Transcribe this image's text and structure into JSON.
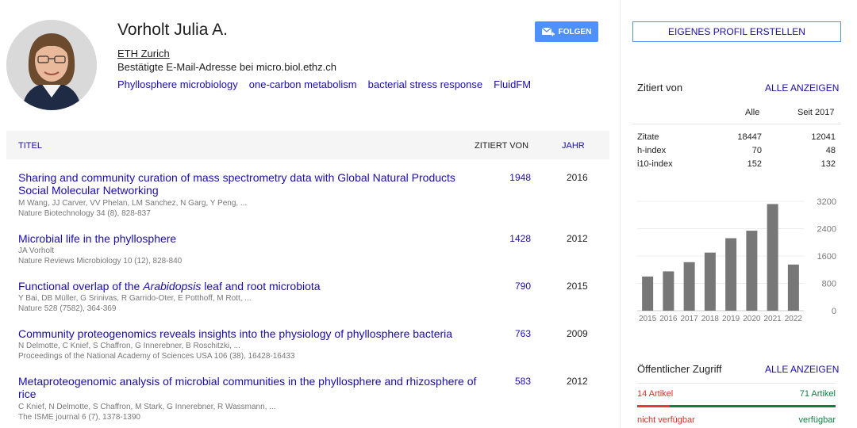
{
  "profile": {
    "name": "Vorholt Julia A.",
    "affiliation": "ETH Zurich",
    "email_status": "Bestätigte E-Mail-Adresse bei micro.biol.ethz.ch",
    "interests": [
      "Phyllosphere microbiology",
      "one-carbon metabolism",
      "bacterial stress response",
      "FluidFM"
    ],
    "follow_label": "FOLGEN",
    "create_profile_label": "EIGENES PROFIL ERSTELLEN"
  },
  "table": {
    "headers": {
      "title": "TITEL",
      "cited_by": "ZITIERT VON",
      "year": "JAHR"
    },
    "rows": [
      {
        "title": "Sharing and community curation of mass spectrometry data with Global Natural Products Social Molecular Networking",
        "authors": "M Wang, JJ Carver, VV Phelan, LM Sanchez, N Garg, Y Peng, ...",
        "venue": "Nature Biotechnology 34 (8), 828-837",
        "cited_by": "1948",
        "year": "2016"
      },
      {
        "title": "Microbial life in the phyllosphere",
        "authors": "JA Vorholt",
        "venue": "Nature Reviews Microbiology 10 (12), 828-840",
        "cited_by": "1428",
        "year": "2012"
      },
      {
        "title_pre": "Functional overlap of the ",
        "title_em": "Arabidopsis",
        "title_post": " leaf and root microbiota",
        "authors": "Y Bai, DB Müller, G Srinivas, R Garrido-Oter, E Potthoff, M Rott, ...",
        "venue": "Nature 528 (7582), 364-369",
        "cited_by": "790",
        "year": "2015"
      },
      {
        "title": "Community proteogenomics reveals insights into the physiology of phyllosphere bacteria",
        "authors": "N Delmotte, C Knief, S Chaffron, G Innerebner, B Roschitzki, ...",
        "venue": "Proceedings of the National Academy of Sciences USA 106 (38), 16428-16433",
        "cited_by": "763",
        "year": "2009"
      },
      {
        "title": "Metaproteogenomic analysis of microbial communities in the phyllosphere and rhizosphere of rice",
        "authors": "C Knief, N Delmotte, S Chaffron, M Stark, G Innerebner, R Wassmann, ...",
        "venue": "The ISME journal 6 (7), 1378-1390",
        "cited_by": "583",
        "year": "2012"
      }
    ]
  },
  "cited_by": {
    "title": "Zitiert von",
    "view_all": "ALLE ANZEIGEN",
    "col_all": "Alle",
    "col_since": "Seit 2017",
    "rows": [
      {
        "label": "Zitate",
        "all": "18447",
        "since": "12041"
      },
      {
        "label": "h-index",
        "all": "70",
        "since": "48"
      },
      {
        "label": "i10-index",
        "all": "152",
        "since": "132"
      }
    ]
  },
  "chart_data": {
    "type": "bar",
    "categories": [
      "2015",
      "2016",
      "2017",
      "2018",
      "2019",
      "2020",
      "2021",
      "2022"
    ],
    "values": [
      1000,
      1150,
      1420,
      1700,
      2120,
      2340,
      3120,
      1350
    ],
    "y_ticks": [
      0,
      800,
      1600,
      2400,
      3200
    ],
    "ylim": [
      0,
      3200
    ],
    "bar_color": "#777777"
  },
  "public_access": {
    "title": "Öffentlicher Zugriff",
    "view_all": "ALLE ANZEIGEN",
    "unavailable_count": "14 Artikel",
    "available_count": "71 Artikel",
    "unavailable_label": "nicht verfügbar",
    "available_label": "verfügbar",
    "unavailable_fraction": 0.165
  }
}
